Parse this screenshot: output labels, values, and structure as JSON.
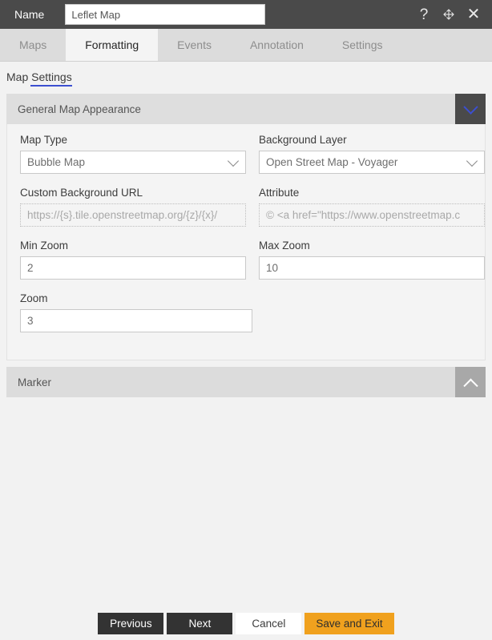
{
  "titlebar": {
    "name_label": "Name",
    "name_value": "Leflet Map",
    "help_icon": "question-mark-icon",
    "move_icon": "move-arrows-icon",
    "close_icon": "close-icon"
  },
  "tabs": [
    {
      "label": "Maps",
      "active": false
    },
    {
      "label": "Formatting",
      "active": true
    },
    {
      "label": "Events",
      "active": false
    },
    {
      "label": "Annotation",
      "active": false
    },
    {
      "label": "Settings",
      "active": false
    }
  ],
  "section_link": {
    "label": "Map Settings"
  },
  "panels": [
    {
      "title": "General Map Appearance",
      "collapsed": false,
      "toggle_icon": "chevron-down-icon"
    },
    {
      "title": "Marker",
      "collapsed": true,
      "toggle_icon": "chevron-up-icon"
    }
  ],
  "fields": {
    "map_type": {
      "label": "Map Type",
      "value": "Bubble Map"
    },
    "background_layer": {
      "label": "Background Layer",
      "value": "Open Street Map - Voyager"
    },
    "custom_background_url": {
      "label": "Custom Background URL",
      "placeholder": "https://{s}.tile.openstreetmap.org/{z}/{x}/"
    },
    "attribute": {
      "label": "Attribute",
      "placeholder": "© <a href=\"https://www.openstreetmap.c"
    },
    "min_zoom": {
      "label": "Min Zoom",
      "value": "2"
    },
    "max_zoom": {
      "label": "Max Zoom",
      "value": "10"
    },
    "zoom": {
      "label": "Zoom",
      "value": "3"
    }
  },
  "footer": {
    "previous": "Previous",
    "next": "Next",
    "cancel": "Cancel",
    "save_and_exit": "Save and Exit"
  },
  "colors": {
    "titlebar_bg": "#4a4a4a",
    "accent_blue": "#3c4fd0",
    "save_orange": "#f0a11e",
    "page_bg": "#f2f2f2"
  }
}
